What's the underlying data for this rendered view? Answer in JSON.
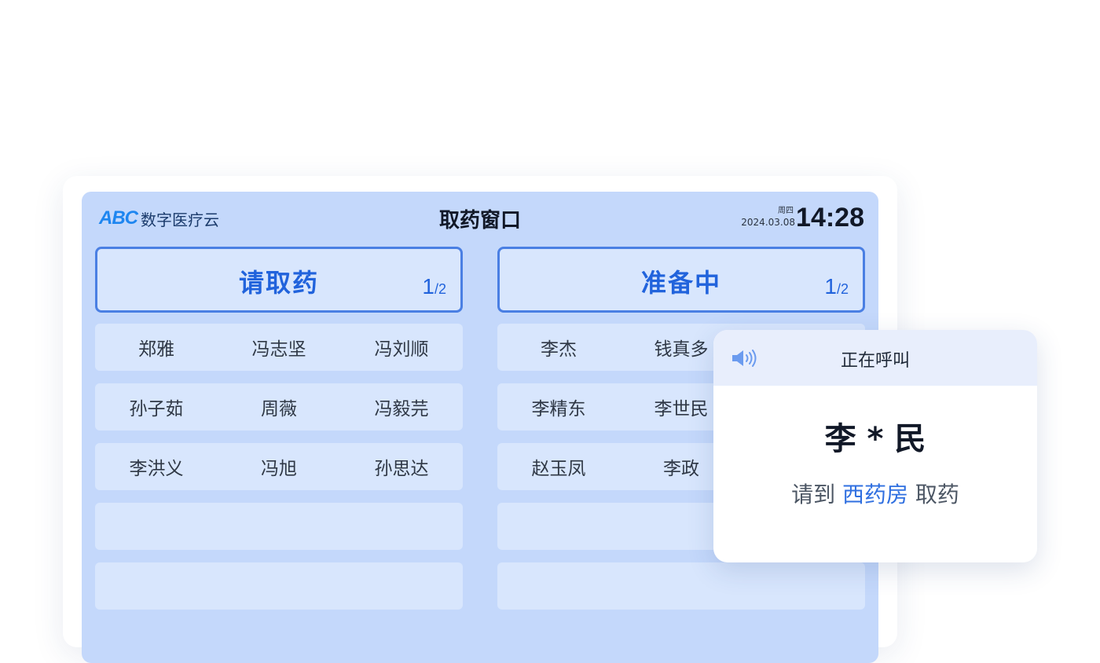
{
  "header": {
    "logo_mark": "ABC",
    "logo_text": "数字医疗云",
    "title": "取药窗口",
    "weekday": "周四",
    "date": "2024.03.08",
    "time": "14:28"
  },
  "panels": [
    {
      "title": "请取药",
      "page_current": "1",
      "page_total": "/2",
      "rows": [
        [
          "郑雅",
          "冯志坚",
          "冯刘顺"
        ],
        [
          "孙子茹",
          "周薇",
          "冯毅芫"
        ],
        [
          "李洪义",
          "冯旭",
          "孙思达"
        ],
        [
          "",
          "",
          ""
        ],
        [
          "",
          "",
          ""
        ]
      ]
    },
    {
      "title": "准备中",
      "page_current": "1",
      "page_total": "/2",
      "rows": [
        [
          "李杰",
          "钱真多",
          ""
        ],
        [
          "李精东",
          "李世民",
          ""
        ],
        [
          "赵玉凤",
          "李政",
          ""
        ],
        [
          "",
          "",
          ""
        ],
        [
          "",
          "",
          ""
        ]
      ]
    }
  ],
  "calling": {
    "label": "正在呼叫",
    "name": "李 * 民",
    "prefix": "请到",
    "location": "西药房",
    "suffix": "取药",
    "icon": "speaker-icon"
  },
  "colors": {
    "accent": "#2163dc",
    "screen_bg": "#c4d8fb",
    "row_bg": "#d8e6fd",
    "border": "#4a7fe3"
  }
}
